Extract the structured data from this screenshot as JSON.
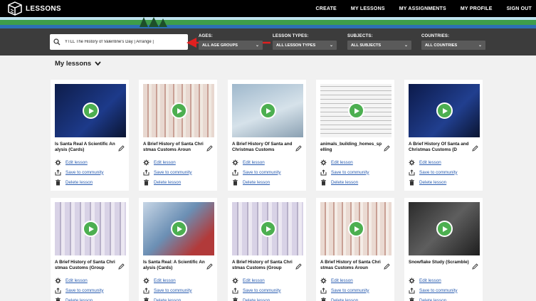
{
  "brand": {
    "name": "LESSONS"
  },
  "nav": [
    "CREATE",
    "MY LESSONS",
    "MY ASSIGNMENTS",
    "MY PROFILE",
    "SIGN OUT"
  ],
  "search": {
    "value": "YTLL The History of Valentine's Day | Arrange |"
  },
  "filters": [
    {
      "label": "AGES:",
      "value": "ALL AGE GROUPS"
    },
    {
      "label": "LESSON TYPES:",
      "value": "ALL LESSON TYPES"
    },
    {
      "label": "SUBJECTS:",
      "value": "ALL SUBJECTS"
    },
    {
      "label": "COUNTRIES:",
      "value": "ALL COUNTRIES"
    }
  ],
  "section": {
    "title": "My lessons"
  },
  "actions": {
    "edit": "Edit lesson",
    "save": "Save to community",
    "delete": "Delete lesson"
  },
  "colors": {
    "play": "#4caf50",
    "link": "#2a5db0",
    "filterbar": "#3c3c3c"
  },
  "lessons": [
    {
      "title": "Is Santa Real A Scientific Analysis (Cards)"
    },
    {
      "title": "A Brief History of Santa Christmas Customs Aroun"
    },
    {
      "title": "A Brief History Of Santa and Christmas Customs"
    },
    {
      "title": "animals_building_homes_spelling"
    },
    {
      "title": "A Brief History Of Santa and Christmas Customs (D"
    },
    {
      "title": "A Brief History of Santa Christmas Customs (Group"
    },
    {
      "title": "Is Santa Real: A Scientific Analysis (Cards)"
    },
    {
      "title": "A Brief History of Santa Christmas Customs (Group"
    },
    {
      "title": "A Brief History of Santa Christmas Customs Aroun"
    },
    {
      "title": "Snowflake Study (Scramble)"
    }
  ]
}
